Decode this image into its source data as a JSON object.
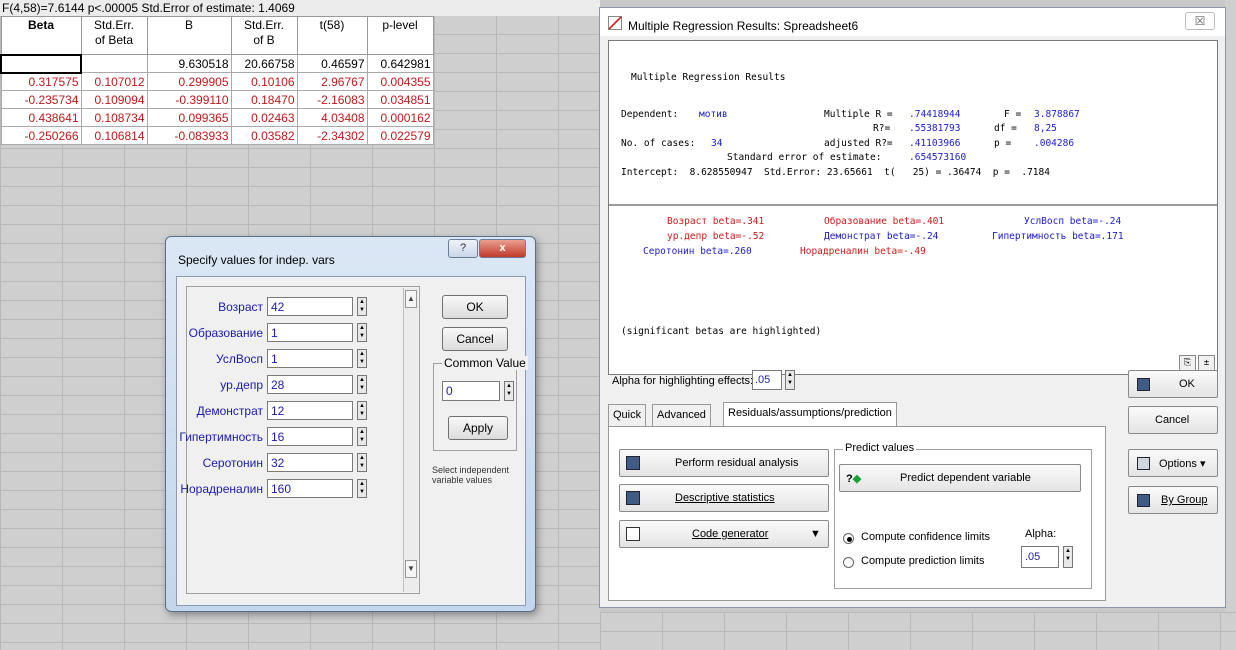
{
  "spreadsheet": {
    "header": "F(4,58)=7.6144 p<.00005 Std.Error of estimate: 1.4069",
    "columns": [
      "Beta",
      "Std.Err.\nof Beta",
      "B",
      "Std.Err.\nof B",
      "t(58)",
      "p-level"
    ],
    "rows": [
      [
        "",
        "",
        "9.630518",
        "20.66758",
        "0.46597",
        "0.642981"
      ],
      [
        "0.317575",
        "0.107012",
        "0.299905",
        "0.10106",
        "2.96767",
        "0.004355"
      ],
      [
        "-0.235734",
        "0.109094",
        "-0.399110",
        "0.18470",
        "-2.16083",
        "0.034851"
      ],
      [
        "0.438641",
        "0.108734",
        "0.099365",
        "0.02463",
        "4.03408",
        "0.000162"
      ],
      [
        "-0.250266",
        "0.106814",
        "-0.083933",
        "0.03582",
        "-2.34302",
        "0.022579"
      ]
    ]
  },
  "specify_dialog": {
    "title": "Specify values for indep. vars",
    "help_label": "?",
    "close_label": "x",
    "variables": [
      {
        "label": "Возраст",
        "value": "42"
      },
      {
        "label": "Образование",
        "value": "1"
      },
      {
        "label": "УслВосп",
        "value": "1"
      },
      {
        "label": "ур.депр",
        "value": "28"
      },
      {
        "label": "Демонстрат",
        "value": "12"
      },
      {
        "label": "Гипертимность",
        "value": "16"
      },
      {
        "label": "Серотонин",
        "value": "32"
      },
      {
        "label": "Норадреналин",
        "value": "160"
      }
    ],
    "ok_label": "OK",
    "cancel_label": "Cancel",
    "common_value_label": "Common Value",
    "common_value": "0",
    "apply_label": "Apply",
    "hint": "Select independent variable values"
  },
  "results_window": {
    "title": "Multiple Regression Results: Spreadsheet6",
    "close_label": "☒",
    "output": {
      "heading": "Multiple Regression Results",
      "dependent_label": "Dependent:",
      "dependent_value": "мотив",
      "multiple_r_label": "Multiple R =",
      "multiple_r": ".74418944",
      "f_label": "F =",
      "f_value": "3.878867",
      "r2_label": "R?=",
      "r2_value": ".55381793",
      "df_label": "df =",
      "df_value": "8,25",
      "cases_label": "No. of cases:",
      "cases_value": "34",
      "adj_r2_label": "adjusted R?=",
      "adj_r2_value": ".41103966",
      "p_label": "p =",
      "p_value": ".004286",
      "std_err_est_label": "Standard error of estimate:",
      "std_err_est_value": ".654573160",
      "intercept_line": "Intercept:  8.628550947  Std.Error: 23.65661  t(   25) = .36474  p =  .7184",
      "betas": [
        {
          "text": "Возраст beta=.341",
          "sig": true
        },
        {
          "text": "Образование beta=.401",
          "sig": true
        },
        {
          "text": "УслВосп beta=-.24",
          "sig": false
        },
        {
          "text": "ур.депр beta=-.52",
          "sig": true
        },
        {
          "text": "Демонстрат beta=-.24",
          "sig": false
        },
        {
          "text": "Гипертимность beta=.171",
          "sig": false
        },
        {
          "text": "Серотонин beta=.260",
          "sig": false
        },
        {
          "text": "Норадреналин beta=-.49",
          "sig": true
        }
      ],
      "footnote": "(significant betas are highlighted)"
    },
    "alpha_label": "Alpha for highlighting effects:",
    "alpha_value": ".05",
    "tabs": [
      "Quick",
      "Advanced",
      "Residuals/assumptions/prediction"
    ],
    "active_tab": 2,
    "perform_residual_label": "Perform residual analysis",
    "descriptive_label": "Descriptive statistics",
    "code_generator_label": "Code generator",
    "predict_group_label": "Predict values",
    "predict_dependent_label": "Predict dependent variable",
    "compute_confidence_label": "Compute confidence limits",
    "compute_prediction_label": "Compute prediction limits",
    "alpha2_label": "Alpha:",
    "alpha2_value": ".05",
    "ok_label": "OK",
    "cancel_label": "Cancel",
    "options_label": "Options ▾",
    "by_group_label": "By Group"
  },
  "colors": {
    "significant": "#d01818",
    "normal": "#1b1bd0"
  }
}
